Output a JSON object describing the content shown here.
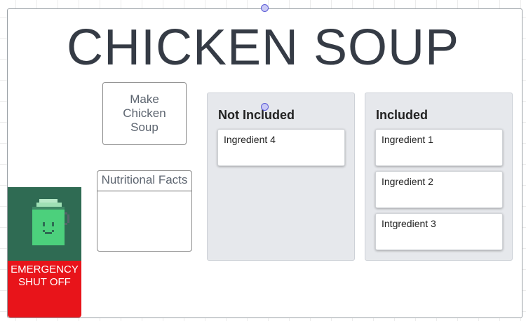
{
  "page": {
    "title": "CHICKEN SOUP"
  },
  "actions": {
    "make_label": "Make Chicken Soup",
    "emergency_label": "EMERGENCY SHUT OFF"
  },
  "nutrition": {
    "title": "Nutritional Facts"
  },
  "columns": [
    {
      "title": "Not Included",
      "items": [
        "Ingredient 4"
      ]
    },
    {
      "title": "Included",
      "items": [
        "Ingredient 1",
        "Ingredient 2",
        "Intgredient 3"
      ]
    }
  ],
  "icons": {
    "status": "battery-face-icon"
  },
  "colors": {
    "emergency": "#e8141a",
    "icon_tile": "#2f6b53",
    "panel": "#e6e8ec",
    "title_text": "#353b45"
  }
}
